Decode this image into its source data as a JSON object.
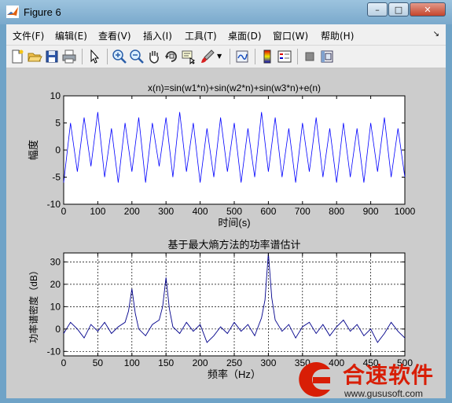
{
  "window": {
    "title": "Figure 6"
  },
  "window_controls": {
    "minimize": "–",
    "maximize": "□",
    "close": "✕"
  },
  "menubar": {
    "items": [
      "文件(F)",
      "编辑(E)",
      "查看(V)",
      "插入(I)",
      "工具(T)",
      "桌面(D)",
      "窗口(W)",
      "帮助(H)"
    ],
    "overflow_icon": "dock-arrow-icon"
  },
  "toolbar": {
    "buttons": [
      "new-figure-icon",
      "open-file-icon",
      "save-icon",
      "print-icon",
      "pointer-icon",
      "zoom-in-icon",
      "zoom-out-icon",
      "pan-hand-icon",
      "rotate-3d-icon",
      "data-cursor-icon",
      "brush-icon",
      "link-plot-icon",
      "colorbar-icon",
      "legend-icon",
      "hide-plot-tools-icon",
      "show-plot-tools-icon"
    ]
  },
  "colors": {
    "signal": "#0000ff",
    "psd": "#00008b",
    "axes_bg": "#ffffff",
    "figure_bg": "#cccccc",
    "watermark": "#d81e06"
  },
  "chart_data": [
    {
      "type": "line",
      "title": "x(n)=sin(w1*n)+sin(w2*n)+sin(w3*n)+e(n)",
      "xlabel": "时间(s)",
      "ylabel": "幅度",
      "xlim": [
        0,
        1000
      ],
      "ylim": [
        -10,
        10
      ],
      "xticks": [
        0,
        100,
        200,
        300,
        400,
        500,
        600,
        700,
        800,
        900,
        1000
      ],
      "yticks": [
        -10,
        -5,
        0,
        5,
        10
      ],
      "grid": false,
      "series": [
        {
          "x": [
            0,
            20,
            40,
            60,
            80,
            100,
            120,
            140,
            160,
            180,
            200,
            220,
            240,
            260,
            280,
            300,
            320,
            340,
            360,
            380,
            400,
            420,
            440,
            460,
            480,
            500,
            520,
            540,
            560,
            580,
            600,
            620,
            640,
            660,
            680,
            700,
            720,
            740,
            760,
            780,
            800,
            820,
            840,
            860,
            880,
            900,
            920,
            940,
            960,
            980,
            1000
          ],
          "y": [
            -6,
            5,
            -4,
            6,
            -3,
            7,
            -5,
            4,
            -6,
            5,
            -4,
            6,
            -6,
            5,
            -3,
            6,
            -5,
            7,
            -4,
            5,
            -6,
            4,
            -5,
            6,
            -4,
            5,
            -6,
            4,
            -5,
            7,
            -4,
            6,
            -5,
            4,
            -6,
            5,
            -4,
            6,
            -5,
            4,
            -6,
            5,
            -5,
            4,
            -6,
            5,
            -4,
            6,
            -5,
            4,
            -5
          ]
        }
      ]
    },
    {
      "type": "line",
      "title": "基于最大熵方法的功率谱估计",
      "xlabel": "频率（Hz）",
      "ylabel": "功率谱密度（dB）",
      "xlim": [
        0,
        500
      ],
      "ylim": [
        -12,
        34
      ],
      "xticks": [
        0,
        50,
        100,
        150,
        200,
        250,
        300,
        350,
        400,
        450,
        500
      ],
      "yticks": [
        -10,
        0,
        10,
        20,
        30
      ],
      "grid": true,
      "series": [
        {
          "x": [
            0,
            10,
            20,
            30,
            40,
            50,
            60,
            70,
            80,
            90,
            95,
            100,
            105,
            110,
            120,
            130,
            140,
            145,
            150,
            155,
            160,
            170,
            180,
            190,
            200,
            210,
            220,
            230,
            240,
            250,
            260,
            270,
            280,
            290,
            295,
            300,
            305,
            310,
            320,
            330,
            340,
            350,
            360,
            370,
            380,
            390,
            400,
            410,
            420,
            430,
            440,
            450,
            460,
            470,
            480,
            490,
            500
          ],
          "y": [
            -2,
            3,
            0,
            -4,
            2,
            -1,
            3,
            -2,
            1,
            3,
            8,
            18,
            7,
            0,
            -3,
            2,
            4,
            10,
            23,
            9,
            1,
            -2,
            3,
            -1,
            2,
            -6,
            -3,
            1,
            -2,
            3,
            -1,
            2,
            -3,
            5,
            13,
            34,
            14,
            4,
            -1,
            2,
            -4,
            1,
            3,
            -2,
            2,
            -3,
            1,
            4,
            -1,
            2,
            -3,
            0,
            -6,
            -2,
            3,
            -1,
            -4
          ]
        }
      ]
    }
  ],
  "watermark": {
    "logo_icon": "gusu-logo-icon",
    "name": "合速软件",
    "url": "www.gususoft.com"
  }
}
